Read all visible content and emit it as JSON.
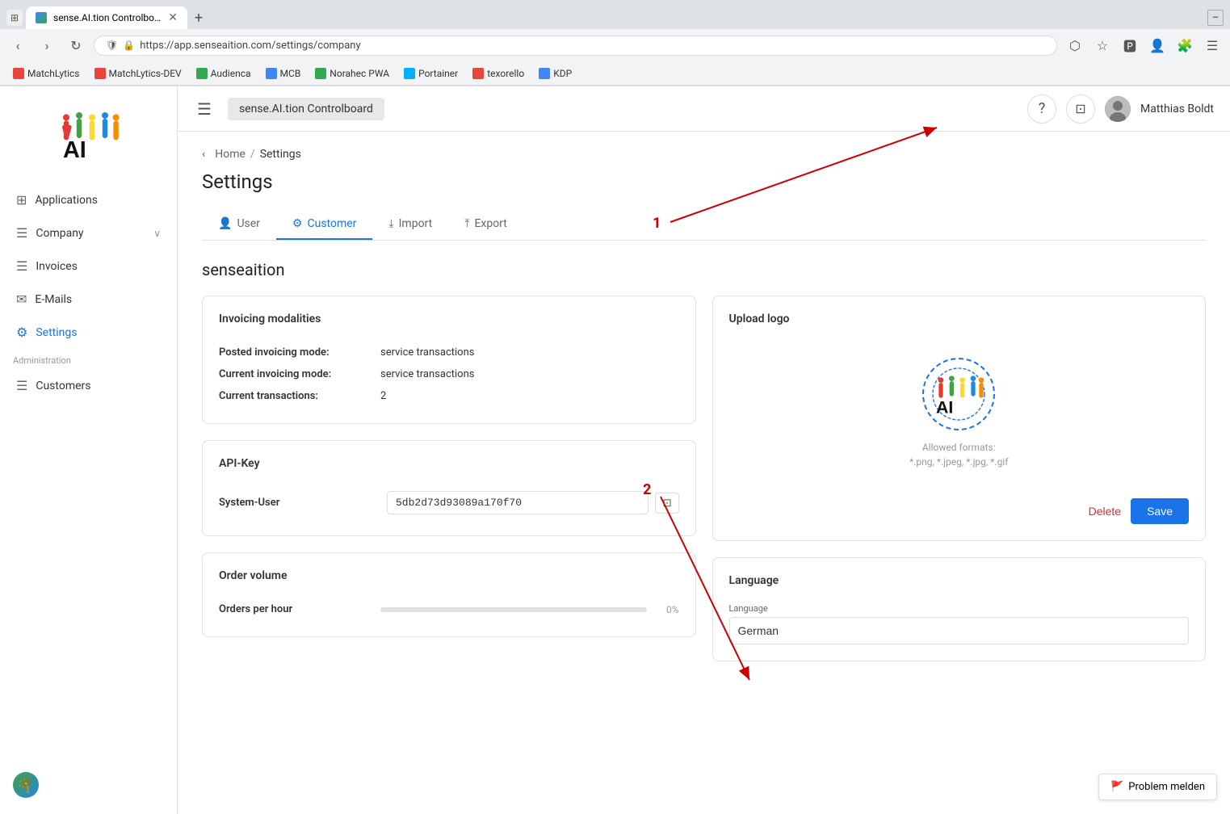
{
  "browser": {
    "tab_title": "sense.AI.tion Controlboard",
    "url": "https://app.senseaition.com/settings/company",
    "bookmarks": [
      {
        "label": "MatchLytics",
        "color": "#e8453c"
      },
      {
        "label": "MatchLytics-DEV",
        "color": "#e8453c"
      },
      {
        "label": "Audienca",
        "color": "#34a853"
      },
      {
        "label": "MCB",
        "color": "#4285f4"
      },
      {
        "label": "Norahec PWA",
        "color": "#34a853"
      },
      {
        "label": "Portainer",
        "color": "#00b0ff"
      },
      {
        "label": "texorello",
        "color": "#e8453c"
      },
      {
        "label": "KDP",
        "color": "#4285f4"
      }
    ]
  },
  "header": {
    "app_title": "sense.AI.tion Controlboard",
    "user_name": "Matthias Boldt"
  },
  "sidebar": {
    "items": [
      {
        "label": "Applications",
        "icon": "⊞",
        "section": ""
      },
      {
        "label": "Company",
        "icon": "☰",
        "section": "",
        "has_chevron": true
      },
      {
        "label": "Invoices",
        "icon": "☰",
        "section": ""
      },
      {
        "label": "E-Mails",
        "icon": "✉",
        "section": ""
      },
      {
        "label": "Settings",
        "icon": "⚙",
        "section": "",
        "active": true
      }
    ],
    "admin_section_label": "Administration",
    "admin_items": [
      {
        "label": "Customers",
        "icon": "☰"
      }
    ]
  },
  "breadcrumb": {
    "home": "Home",
    "current": "Settings"
  },
  "page": {
    "title": "Settings"
  },
  "tabs": [
    {
      "label": "User",
      "icon": "👤",
      "active": false
    },
    {
      "label": "Customer",
      "icon": "⚙",
      "active": true
    },
    {
      "label": "Import",
      "icon": "⤓",
      "active": false
    },
    {
      "label": "Export",
      "icon": "⤒",
      "active": false
    }
  ],
  "company_name": "senseaition",
  "invoicing_modalities": {
    "card_title": "Invoicing modalities",
    "fields": [
      {
        "label": "Posted invoicing mode:",
        "value": "service transactions"
      },
      {
        "label": "Current invoicing mode:",
        "value": "service transactions"
      },
      {
        "label": "Current transactions:",
        "value": "2"
      }
    ]
  },
  "upload_logo": {
    "card_title": "Upload logo",
    "allowed_formats": "Allowed formats:",
    "formats_list": "*.png, *.jpeg, *.jpg, *.gif",
    "delete_label": "Delete",
    "save_label": "Save"
  },
  "api_key": {
    "card_title": "API-Key",
    "system_user_label": "System-User",
    "system_user_value": "5db2d73d93089a170f70"
  },
  "language": {
    "card_title": "Language",
    "language_label": "Language",
    "language_value": "German"
  },
  "order_volume": {
    "card_title": "Order volume",
    "orders_per_hour_label": "Orders per hour",
    "progress_pct": "0%"
  },
  "annotations": {
    "label_1": "1",
    "label_2": "2"
  },
  "problem_btn": {
    "label": "Problem melden"
  }
}
